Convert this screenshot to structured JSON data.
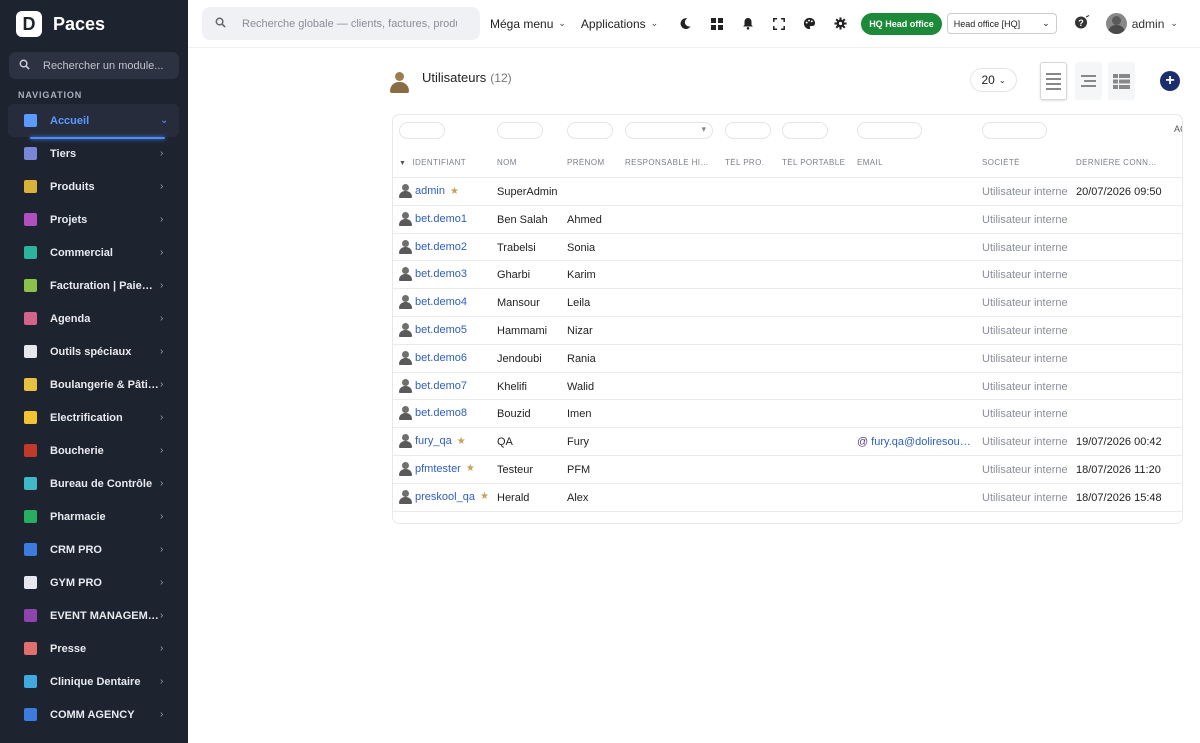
{
  "brand": {
    "logo": "D",
    "name": "Paces"
  },
  "sidebar": {
    "search_placeholder": "Rechercher un module...",
    "nav_title": "NAVIGATION",
    "items": [
      {
        "label": "Accueil",
        "icon": "home-icon",
        "color": "#5b9bff",
        "active": true
      },
      {
        "label": "Tiers",
        "icon": "building-icon",
        "color": "#7a86d6"
      },
      {
        "label": "Produits",
        "icon": "box-icon",
        "color": "#d9b23a"
      },
      {
        "label": "Projets",
        "icon": "project-icon",
        "color": "#b04fbf"
      },
      {
        "label": "Commercial",
        "icon": "briefcase-icon",
        "color": "#2bb39b"
      },
      {
        "label": "Facturation | Paiement",
        "icon": "invoice-icon",
        "color": "#8bc34a"
      },
      {
        "label": "Agenda",
        "icon": "calendar-icon",
        "color": "#d2648a"
      },
      {
        "label": "Outils spéciaux",
        "icon": "tools-icon",
        "color": "#e6e8ee"
      },
      {
        "label": "Boulangerie & Pâtisserie",
        "icon": "bread-icon",
        "color": "#e8c040"
      },
      {
        "label": "Electrification",
        "icon": "bolt-icon",
        "color": "#f4c430"
      },
      {
        "label": "Boucherie",
        "icon": "meat-icon",
        "color": "#c0392b"
      },
      {
        "label": "Bureau de Contrôle",
        "icon": "shield-icon",
        "color": "#3fb8c8"
      },
      {
        "label": "Pharmacie",
        "icon": "cross-icon",
        "color": "#27ae60"
      },
      {
        "label": "CRM PRO",
        "icon": "funnel-icon",
        "color": "#3d7be0"
      },
      {
        "label": "GYM PRO",
        "icon": "dumbbell-icon",
        "color": "#e6e8ee"
      },
      {
        "label": "EVENT MANAGEMENT",
        "icon": "ticket-icon",
        "color": "#8e44ad"
      },
      {
        "label": "Presse",
        "icon": "newspaper-icon",
        "color": "#e07070"
      },
      {
        "label": "Clinique Dentaire",
        "icon": "tooth-icon",
        "color": "#3fa9e0"
      },
      {
        "label": "COMM AGENCY",
        "icon": "funnel-icon",
        "color": "#3d7be0"
      }
    ]
  },
  "topbar": {
    "search_placeholder": "Recherche globale — clients, factures, produits...",
    "mega_menu": "Méga menu",
    "applications": "Applications",
    "hq_badge": "HQ  Head office",
    "entity": "Head office [HQ]",
    "user": "admin"
  },
  "page": {
    "title": "Utilisateurs",
    "count": "(12)",
    "limit": "20",
    "filter_extra": "AC"
  },
  "table": {
    "headers": [
      "Identifiant",
      "Nom",
      "Prénom",
      "Responsable hiérarchique",
      "Tél pro.",
      "Tél portable",
      "Email",
      "Société",
      "Dernière connexion"
    ],
    "rows": [
      {
        "login": "admin",
        "star": true,
        "nom": "SuperAdmin",
        "prenom": "",
        "email": "",
        "societe": "Utilisateur interne",
        "last": "20/07/2026 09:50"
      },
      {
        "login": "bet.demo1",
        "star": false,
        "nom": "Ben Salah",
        "prenom": "Ahmed",
        "email": "",
        "societe": "Utilisateur interne",
        "last": ""
      },
      {
        "login": "bet.demo2",
        "star": false,
        "nom": "Trabelsi",
        "prenom": "Sonia",
        "email": "",
        "societe": "Utilisateur interne",
        "last": ""
      },
      {
        "login": "bet.demo3",
        "star": false,
        "nom": "Gharbi",
        "prenom": "Karim",
        "email": "",
        "societe": "Utilisateur interne",
        "last": ""
      },
      {
        "login": "bet.demo4",
        "star": false,
        "nom": "Mansour",
        "prenom": "Leila",
        "email": "",
        "societe": "Utilisateur interne",
        "last": ""
      },
      {
        "login": "bet.demo5",
        "star": false,
        "nom": "Hammami",
        "prenom": "Nizar",
        "email": "",
        "societe": "Utilisateur interne",
        "last": ""
      },
      {
        "login": "bet.demo6",
        "star": false,
        "nom": "Jendoubi",
        "prenom": "Rania",
        "email": "",
        "societe": "Utilisateur interne",
        "last": ""
      },
      {
        "login": "bet.demo7",
        "star": false,
        "nom": "Khelifi",
        "prenom": "Walid",
        "email": "",
        "societe": "Utilisateur interne",
        "last": ""
      },
      {
        "login": "bet.demo8",
        "star": false,
        "nom": "Bouzid",
        "prenom": "Imen",
        "email": "",
        "societe": "Utilisateur interne",
        "last": ""
      },
      {
        "login": "fury_qa",
        "star": true,
        "nom": "QA",
        "prenom": "Fury",
        "email": "fury.qa@doliresource.com",
        "societe": "Utilisateur interne",
        "last": "19/07/2026 00:42"
      },
      {
        "login": "pfmtester",
        "star": true,
        "nom": "Testeur",
        "prenom": "PFM",
        "email": "",
        "societe": "Utilisateur interne",
        "last": "18/07/2026 11:20"
      },
      {
        "login": "preskool_qa",
        "star": true,
        "nom": "Herald",
        "prenom": "Alex",
        "email": "",
        "societe": "Utilisateur interne",
        "last": "18/07/2026 15:48"
      }
    ]
  },
  "colors": {
    "sidebar_bg": "#1e2330",
    "accent": "#5b9bff",
    "link": "#2f5fbf",
    "hq_green": "#1d8a3a",
    "add_btn": "#1a2d6e"
  }
}
